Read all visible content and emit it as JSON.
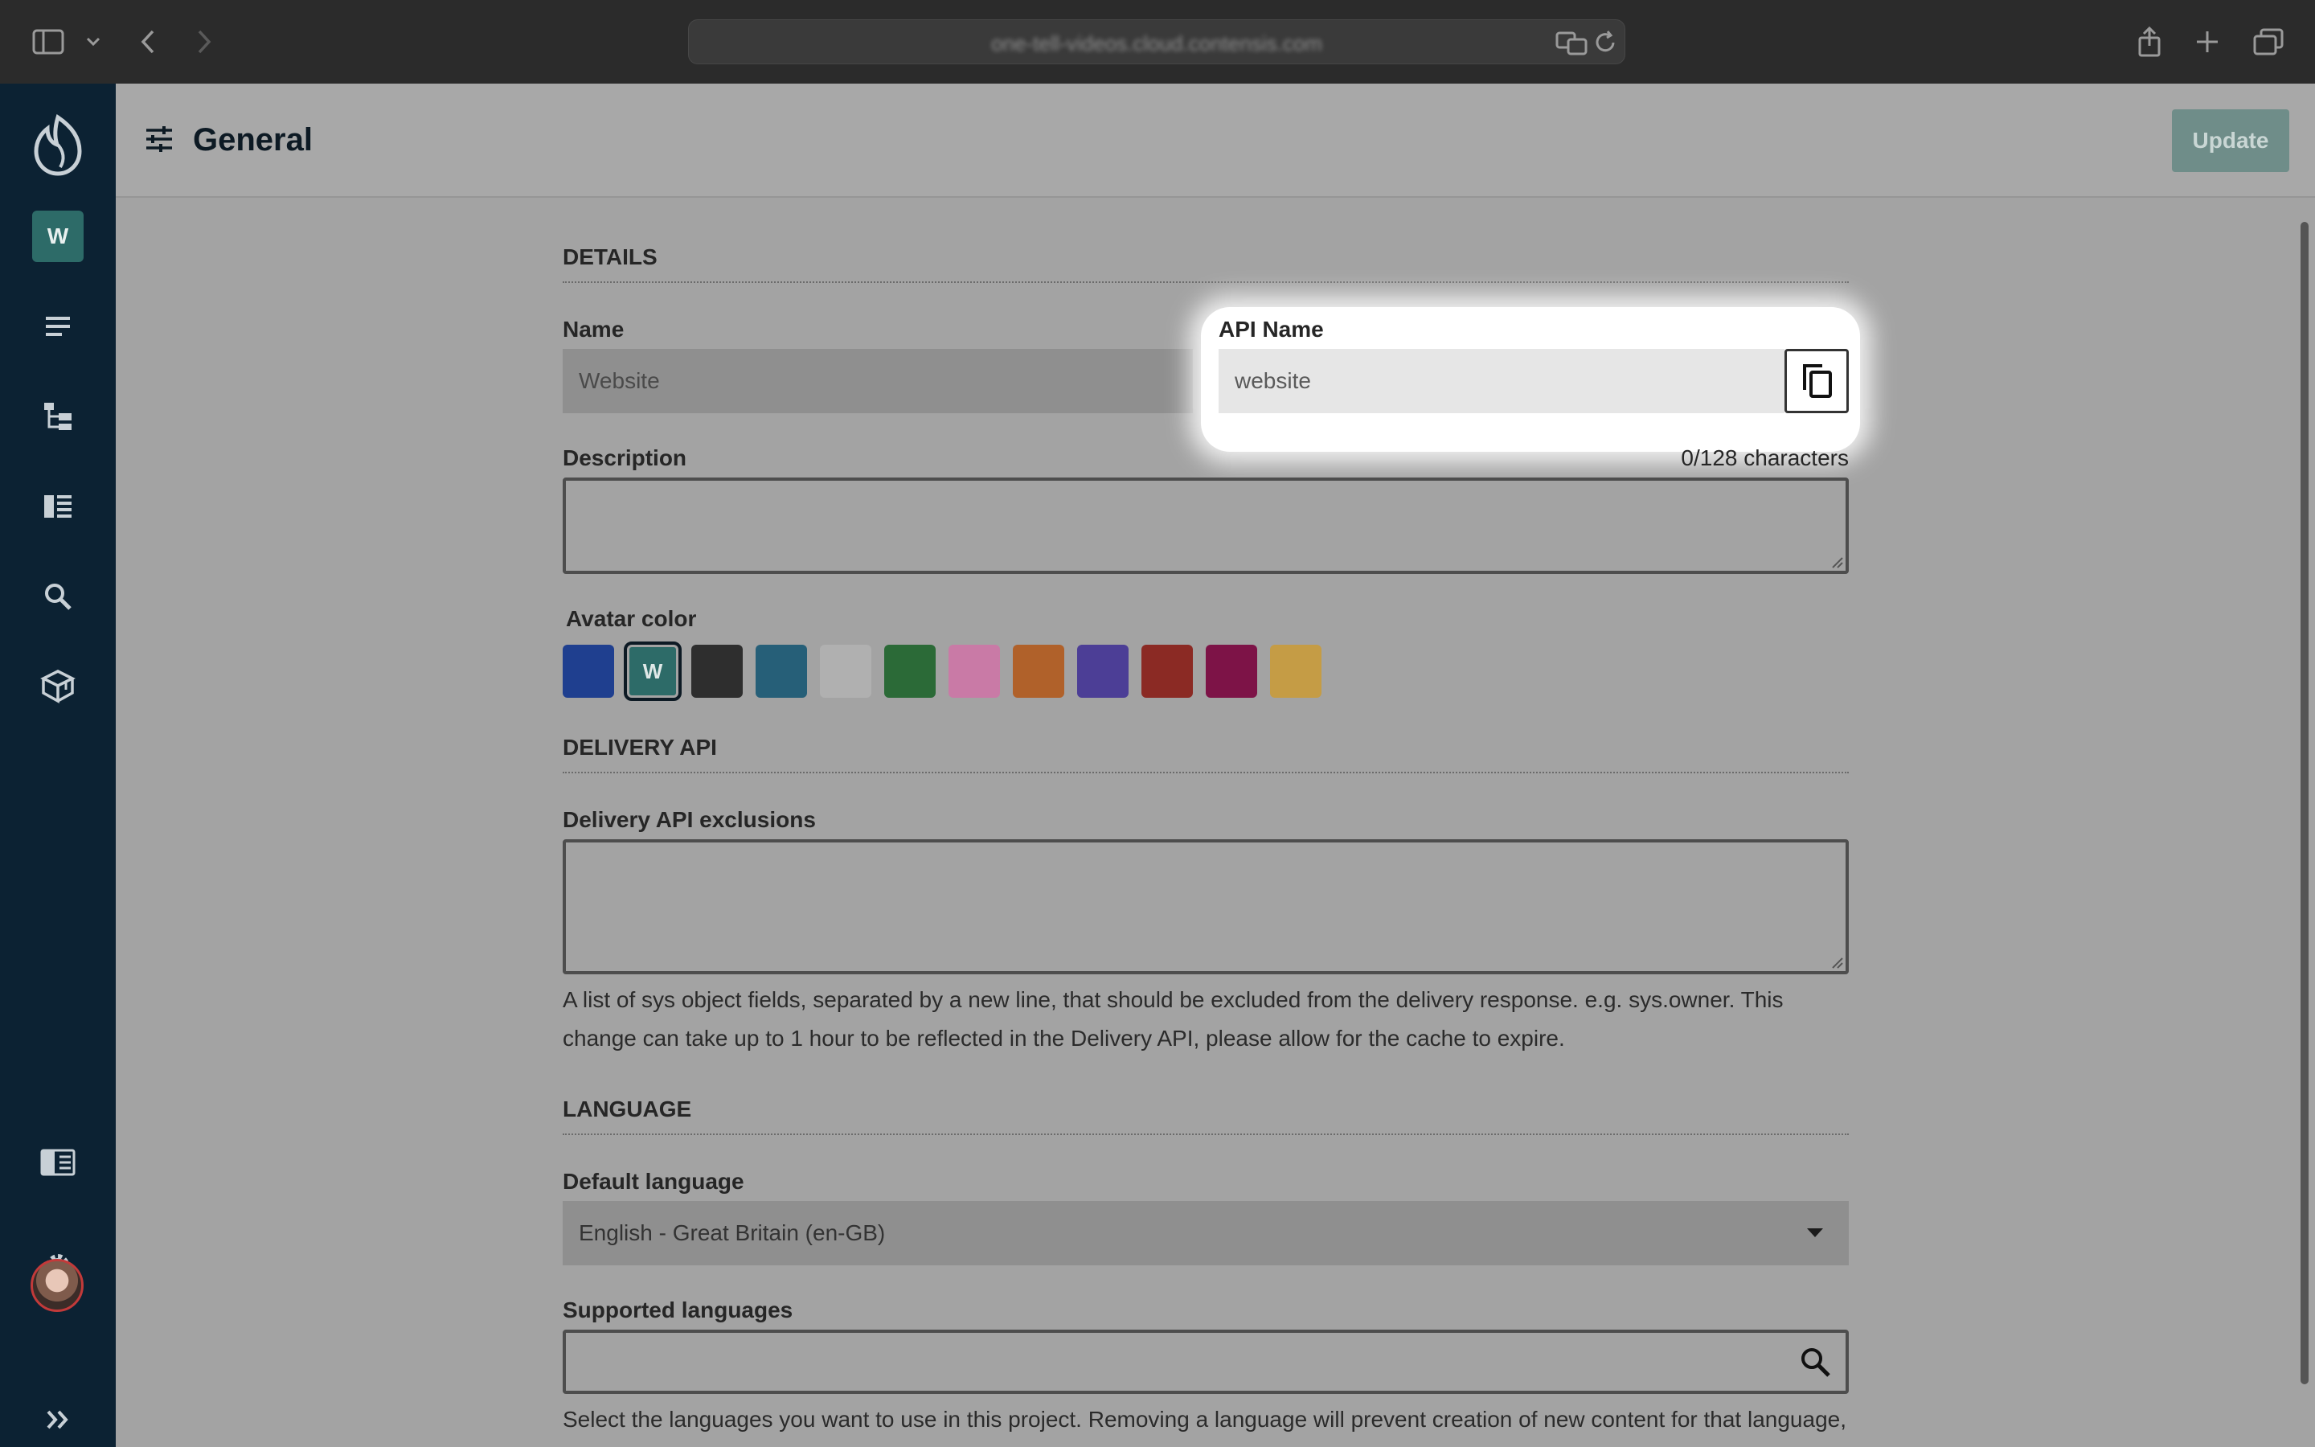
{
  "browser": {
    "url": "one-tell-videos.cloud.contensis.com"
  },
  "sidebar": {
    "project_initial": "W",
    "items": [
      {
        "name": "entries",
        "icon": "list-icon"
      },
      {
        "name": "site-view",
        "icon": "sitemap-icon"
      },
      {
        "name": "content-types",
        "icon": "content-types-icon"
      },
      {
        "name": "search",
        "icon": "search-icon"
      },
      {
        "name": "blocks",
        "icon": "blocks-icon"
      },
      {
        "name": "panel",
        "icon": "panel-icon"
      },
      {
        "name": "settings",
        "icon": "gear-icon"
      },
      {
        "name": "expand",
        "icon": "expand-icon"
      }
    ]
  },
  "header": {
    "title": "General",
    "update_label": "Update"
  },
  "details": {
    "section_title": "DETAILS",
    "name_label": "Name",
    "name_value": "Website",
    "api_name_label": "API Name",
    "api_name_value": "website",
    "description_label": "Description",
    "description_counter": "0/128 characters",
    "avatar_color_label": "Avatar color",
    "avatar_letter": "W",
    "avatar_colors": [
      "#1f3f8f",
      "#2d6b68",
      "#2e2e2e",
      "#265f78",
      "#b0b0b0",
      "#2b6a37",
      "#c97aa6",
      "#b0612a",
      "#4c3e96",
      "#8b2a24",
      "#7d1347",
      "#c59c45"
    ],
    "selected_color_index": 1
  },
  "delivery": {
    "section_title": "DELIVERY API",
    "exclusions_label": "Delivery API exclusions",
    "help_line1": "A list of sys object fields, separated by a new line, that should be excluded from the delivery response. e.g. sys.owner. This",
    "help_line2": "change can take up to 1 hour to be reflected in the Delivery API, please allow for the cache to expire."
  },
  "language": {
    "section_title": "LANGUAGE",
    "default_label": "Default language",
    "default_value": "English - Great Britain (en-GB)",
    "supported_label": "Supported languages",
    "supported_help": "Select the languages you want to use in this project. Removing a language will prevent creation of new content for that language,"
  }
}
